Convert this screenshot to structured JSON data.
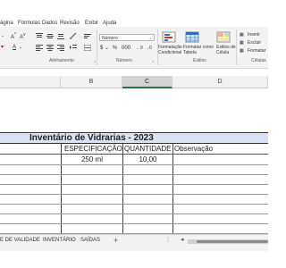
{
  "menu": {
    "tabs": [
      "ágina",
      "Fórmulas",
      "Dados",
      "Revisão",
      "Exibir",
      "Ajuda"
    ]
  },
  "ribbon": {
    "number_format": "Número",
    "groups": {
      "alignment": "Alinhamento",
      "number": "Número",
      "styles": "Estilos",
      "cells": "Células"
    },
    "styles_buttons": {
      "conditional": [
        "Formatação",
        "Condicional"
      ],
      "as_table": [
        "Formatar como",
        "Tabela"
      ],
      "cell_styles": [
        "Estilos de",
        "Célula"
      ]
    },
    "cells_buttons": {
      "insert": "Inserir",
      "delete": "Excluir",
      "format": "Formatar"
    }
  },
  "columns": [
    "B",
    "C",
    "D"
  ],
  "sheet": {
    "title": "Inventário de Vidrarias - 2023",
    "headers": [
      "ESPECIFICAÇÃO",
      "QUANTIDADE",
      "Observação"
    ],
    "rows": [
      [
        "250 ml",
        "10,00",
        ""
      ]
    ]
  },
  "sheet_tabs": [
    "E DE VALIDADE",
    "INVENTÁRIO",
    "SAÍDAS"
  ],
  "add_sheet": "+",
  "overflow_dots": "⋮"
}
